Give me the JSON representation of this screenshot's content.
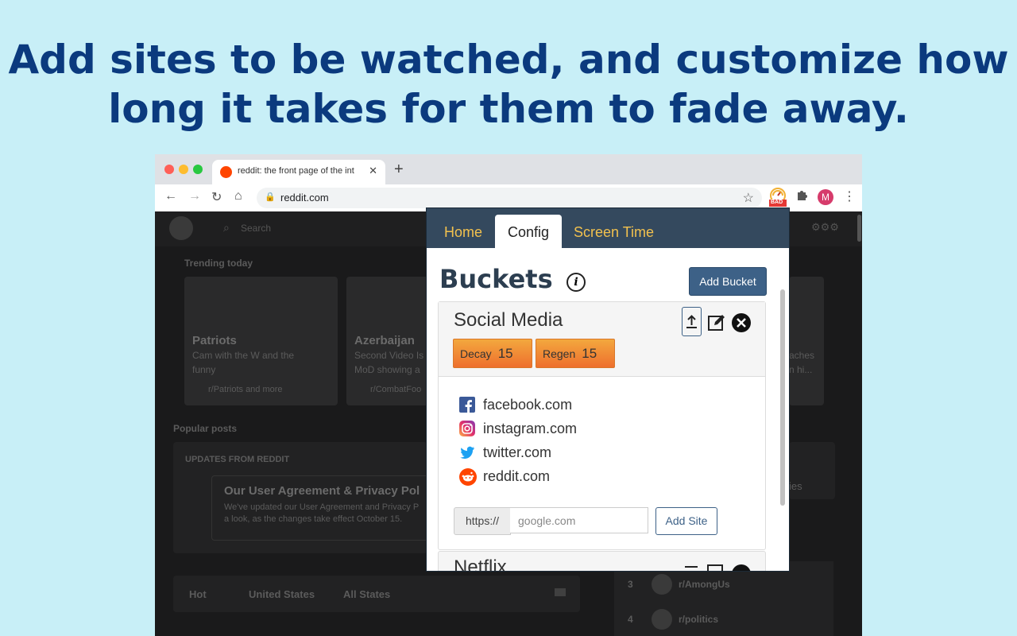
{
  "headline": {
    "line1": "Add sites to be watched, and customize how",
    "line2": "long it takes for them to fade away."
  },
  "browser": {
    "tab_title": "reddit: the front page of the int",
    "url": "reddit.com",
    "extension_badge": "BAD",
    "profile_initial": "M"
  },
  "reddit": {
    "search_placeholder": "Search",
    "trending_label": "Trending today",
    "cards": [
      {
        "title": "Patriots",
        "desc1": "Cam with the W and the",
        "desc2": "funny",
        "sub": "r/Patriots and more"
      },
      {
        "title": "Azerbaijan",
        "desc1": "Second Video Is",
        "desc2": "MoD showing a",
        "sub": "r/CombatFoo"
      }
    ],
    "right_card_text1": "aches",
    "right_card_text2": "n hi...",
    "popular_label": "Popular posts",
    "updates_label": "UPDATES FROM REDDIT",
    "agreement_title": "Our User Agreement & Privacy Pol",
    "agreement_text1": "We've updated our User Agreement and Privacy P",
    "agreement_text2": "a look, as the changes take effect October 15.",
    "side_text": "ies",
    "filters": [
      "Hot",
      "United States",
      "All States"
    ],
    "community_rows": [
      {
        "rank": "3",
        "name": "r/AmongUs"
      },
      {
        "rank": "4",
        "name": "r/politics"
      }
    ]
  },
  "popup": {
    "tabs": [
      "Home",
      "Config",
      "Screen Time"
    ],
    "active_tab": "Config",
    "buckets_title": "Buckets",
    "add_bucket_label": "Add Bucket",
    "bucket": {
      "name": "Social Media",
      "decay_label": "Decay",
      "decay_value": "15",
      "regen_label": "Regen",
      "regen_value": "15",
      "sites": [
        {
          "icon": "facebook-icon",
          "label": "facebook.com"
        },
        {
          "icon": "instagram-icon",
          "label": "instagram.com"
        },
        {
          "icon": "twitter-icon",
          "label": "twitter.com"
        },
        {
          "icon": "reddit-icon",
          "label": "reddit.com"
        }
      ],
      "prefix": "https://",
      "input_placeholder": "google.com",
      "add_site_label": "Add Site"
    },
    "next_bucket_name": "Netflix"
  },
  "colors": {
    "background": "#c8eff7",
    "headline": "#0b3a7e",
    "popup_header": "#34495e",
    "tab_text": "#f2c14e",
    "button": "#3d6187"
  }
}
